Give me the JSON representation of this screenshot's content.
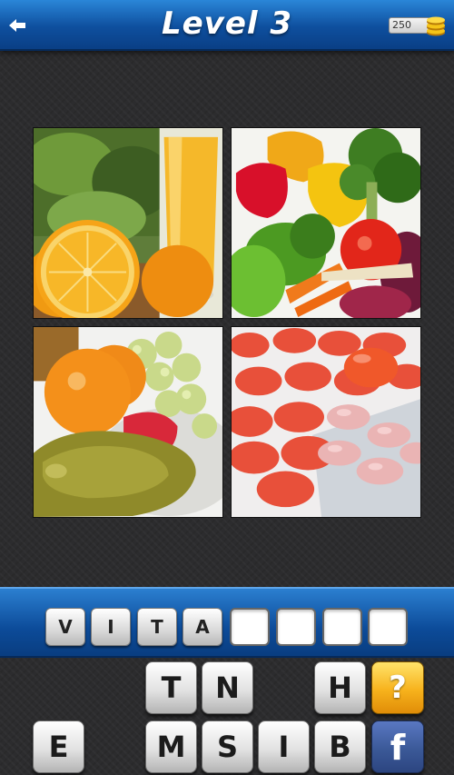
{
  "header": {
    "title": "Level 3",
    "coins": "250",
    "back_icon": "back-arrow-icon",
    "coin_icon": "coin-stack-icon"
  },
  "pictures": [
    {
      "subject": "orange-juice-and-oranges"
    },
    {
      "subject": "vegetables"
    },
    {
      "subject": "fruits"
    },
    {
      "subject": "pills"
    }
  ],
  "answer": {
    "letters": [
      "V",
      "I",
      "T",
      "A",
      "",
      "",
      "",
      ""
    ]
  },
  "letter_keys": {
    "row1": [
      "T",
      "N",
      "H"
    ],
    "row2": [
      "E",
      "M",
      "S",
      "I",
      "B"
    ]
  },
  "actions": {
    "hint_label": "?",
    "facebook_label": "f"
  },
  "colors": {
    "header_blue": "#0e4f9e",
    "hint_yellow": "#f7b21c",
    "facebook_blue": "#3b5998"
  }
}
